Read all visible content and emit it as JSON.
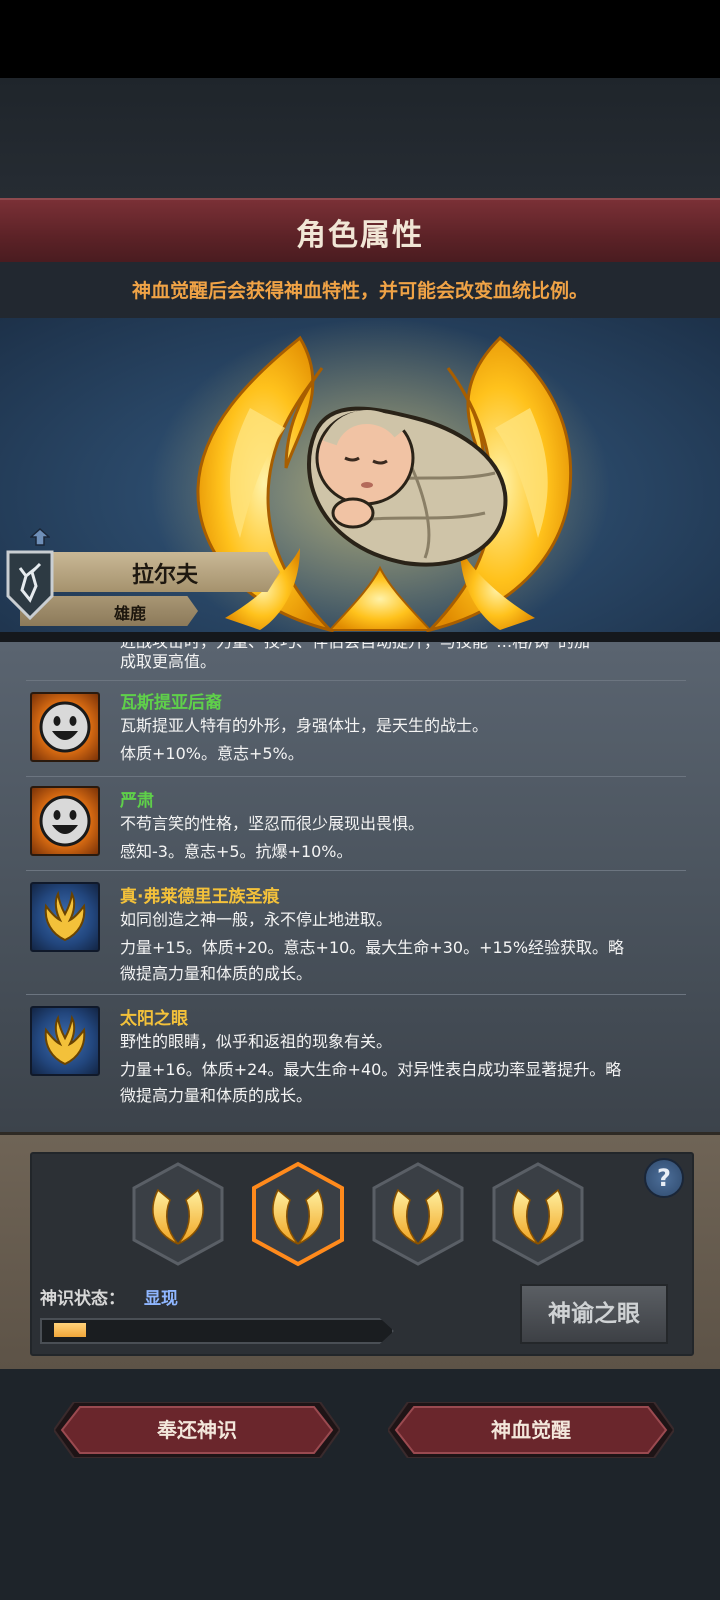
{
  "header": {
    "title": "角色属性",
    "subtitle": "神血觉醒后会获得神血特性，并可能会改变血统比例。"
  },
  "character": {
    "name": "拉尔夫",
    "lineage": "雄鹿"
  },
  "traits": {
    "partial_top_line": "近战攻击时，力量、技巧、伴侣会自动提升，与技能“…格/铸”的加",
    "partial_second_line": "成取更高值。",
    "items": [
      {
        "name": "瓦斯提亚后裔",
        "desc_line1": "瓦斯提亚人特有的外形，身强体壮，是天生的战士。",
        "desc_line2": "体质+10%。意志+5%。",
        "icon": "smiley-face-icon",
        "name_color": "#5fd04a"
      },
      {
        "name": "严肃",
        "desc_line1": "不苟言笑的性格，坚忍而很少展现出畏惧。",
        "desc_line2": "感知-3。意志+5。抗爆+10%。",
        "icon": "smiley-face-icon",
        "name_color": "#5fd04a"
      },
      {
        "name": "真·弗莱德里王族圣痕",
        "desc_line1": "如同创造之神一般，永不停止地进取。",
        "desc_line2": "力量+15。体质+20。意志+10。最大生命+30。+15%经验获取。略",
        "desc_line3": "微提高力量和体质的成长。",
        "icon": "golden-flame-crest-icon",
        "name_color": "#f3c13a"
      },
      {
        "name": "太阳之眼",
        "desc_line1": "野性的眼睛，似乎和返祖的现象有关。",
        "desc_line2": "力量+16。体质+24。最大生命+40。对异性表白成功率显著提升。略",
        "desc_line3": "微提高力量和体质的成长。",
        "icon": "golden-flame-crest-icon",
        "name_color": "#f3c13a"
      }
    ]
  },
  "divine_panel": {
    "slots": [
      "golden-wing-emblem",
      "golden-wing-emblem",
      "golden-wing-emblem",
      "golden-wing-emblem"
    ],
    "selected_slot": 2,
    "status_label": "神识状态：",
    "status_value": "显现",
    "progress": 0.1,
    "oracle_button": "神谕之眼",
    "help_icon": "?"
  },
  "actions": {
    "return_button": "奉还神识",
    "awaken_button": "神血觉醒"
  },
  "colors": {
    "accent_red": "#6a262c",
    "gold": "#f3c13a",
    "trait_green": "#5fd04a",
    "status_blue": "#8fb6ff",
    "subtitle_orange": "#f0a346"
  }
}
